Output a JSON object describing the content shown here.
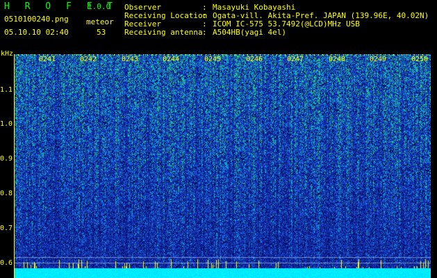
{
  "header": {
    "brand": "H R O F F T",
    "version": "1.0.0",
    "filename": "0510100240.png",
    "datetime": "05.10.10 02:40",
    "meteor_label": "meteor",
    "meteor_count": "53"
  },
  "info": [
    {
      "key": "Observer",
      "value": "Masayuki Kobayashi"
    },
    {
      "key": "Receiving Location",
      "value": "Ogata-vill. Akita-Pref. JAPAN (139.96E, 40.02N)"
    },
    {
      "key": "Receiver",
      "value": "ICOM IC-575 53.7492(@LCD)MHz USB"
    },
    {
      "key": "Receiving antenna",
      "value": "A504HB(yagi 4el)"
    }
  ],
  "colon": ":",
  "axis": {
    "unit": "kHz",
    "y_labels": [
      "1.1",
      "1.0",
      "0.9",
      "0.8",
      "0.7",
      "0.6"
    ],
    "x_labels": [
      "0241",
      "0242",
      "0243",
      "0244",
      "0245",
      "0246",
      "0247",
      "0248",
      "0249",
      "0250"
    ]
  },
  "colors": {
    "background": "#000000",
    "text": "#ffff00",
    "brand": "#00ff00",
    "spectrum_base": "#1838b0",
    "spectrum_bottom_band": "#00d8ff"
  }
}
